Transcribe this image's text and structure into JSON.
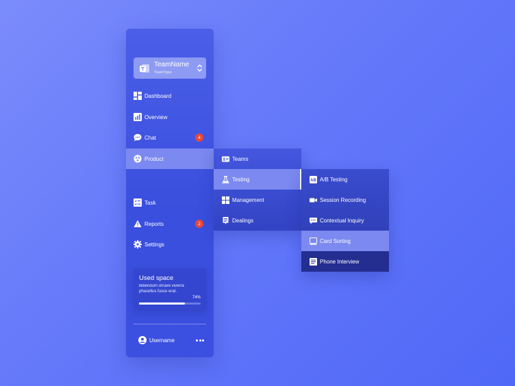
{
  "team": {
    "name": "TeamName",
    "type": "TeamType"
  },
  "nav": [
    {
      "label": "Dashboard"
    },
    {
      "label": "Overview"
    },
    {
      "label": "Chat",
      "badge": "4"
    },
    {
      "label": "Product"
    },
    {
      "label": "Task"
    },
    {
      "label": "Reports",
      "badge": "2"
    },
    {
      "label": "Settings"
    }
  ],
  "product_menu": [
    {
      "label": "Teams"
    },
    {
      "label": "Testing"
    },
    {
      "label": "Management"
    },
    {
      "label": "Dealings"
    }
  ],
  "testing_menu": [
    {
      "label": "A/B Testing"
    },
    {
      "label": "Session Recording"
    },
    {
      "label": "Contextual Inquiry"
    },
    {
      "label": "Card Sorting"
    },
    {
      "label": "Phone Interview"
    }
  ],
  "used_space": {
    "title": "Used space",
    "description": "Bibendum ornare viverra phasellus fusce erat.",
    "percent_label": "74%",
    "percent": 0.74
  },
  "user": {
    "name": "Username"
  },
  "colors": {
    "badge": "#e8483a",
    "active": "#7b89f0",
    "accent": "#3446cf"
  }
}
